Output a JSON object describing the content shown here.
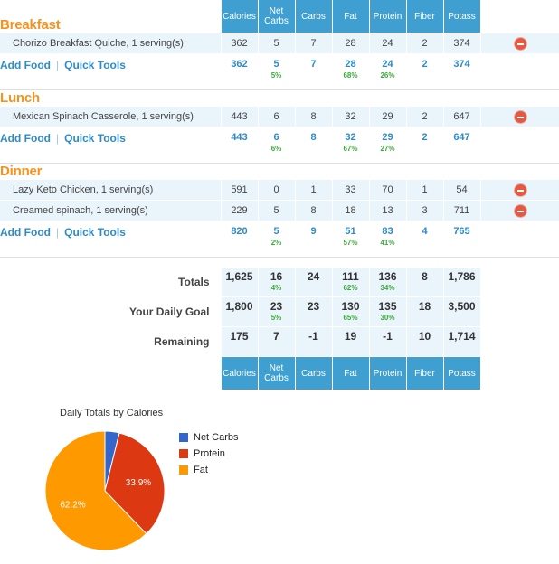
{
  "columns": [
    "Calories",
    "Net Carbs",
    "Carbs",
    "Fat",
    "Protein",
    "Fiber",
    "Potass"
  ],
  "colors": {
    "header_blue": "#3E9FD0",
    "meal_heading_orange": "#F6921E",
    "link_blue": "#2E8BC7",
    "row_bg": "#EAF4FB",
    "percent_green": "#3DA73D",
    "positive_green": "#3DA73D",
    "negative_red": "#E02020",
    "remove_red": "#E8573F"
  },
  "actions": {
    "add_food": "Add Food",
    "separator": "|",
    "quick_tools": "Quick Tools"
  },
  "meals": [
    {
      "name": "Breakfast",
      "foods": [
        {
          "name": "Chorizo Breakfast Quiche, 1 serving(s)",
          "values": [
            "362",
            "5",
            "7",
            "28",
            "24",
            "2",
            "374"
          ]
        }
      ],
      "subtotal": {
        "values": [
          "362",
          "5",
          "7",
          "28",
          "24",
          "2",
          "374"
        ],
        "percents": [
          "",
          "5%",
          "",
          "68%",
          "26%",
          "",
          ""
        ]
      }
    },
    {
      "name": "Lunch",
      "foods": [
        {
          "name": "Mexican Spinach Casserole, 1 serving(s)",
          "values": [
            "443",
            "6",
            "8",
            "32",
            "29",
            "2",
            "647"
          ]
        }
      ],
      "subtotal": {
        "values": [
          "443",
          "6",
          "8",
          "32",
          "29",
          "2",
          "647"
        ],
        "percents": [
          "",
          "6%",
          "",
          "67%",
          "27%",
          "",
          ""
        ]
      }
    },
    {
      "name": "Dinner",
      "foods": [
        {
          "name": "Lazy Keto Chicken, 1 serving(s)",
          "values": [
            "591",
            "0",
            "1",
            "33",
            "70",
            "1",
            "54"
          ]
        },
        {
          "name": "Creamed spinach, 1 serving(s)",
          "values": [
            "229",
            "5",
            "8",
            "18",
            "13",
            "3",
            "711"
          ]
        }
      ],
      "subtotal": {
        "values": [
          "820",
          "5",
          "9",
          "51",
          "83",
          "4",
          "765"
        ],
        "percents": [
          "",
          "2%",
          "",
          "57%",
          "41%",
          "",
          ""
        ]
      }
    }
  ],
  "totals_rows": [
    {
      "label": "Totals",
      "values": [
        "1,625",
        "16",
        "24",
        "111",
        "136",
        "8",
        "1,786"
      ],
      "percents": [
        "",
        "4%",
        "",
        "62%",
        "34%",
        "",
        ""
      ],
      "signs": [
        "",
        "",
        "",
        "",
        "",
        "",
        ""
      ]
    },
    {
      "label": "Your Daily Goal",
      "values": [
        "1,800",
        "23",
        "23",
        "130",
        "135",
        "18",
        "3,500"
      ],
      "percents": [
        "",
        "5%",
        "",
        "65%",
        "30%",
        "",
        ""
      ],
      "signs": [
        "",
        "",
        "",
        "",
        "",
        "",
        ""
      ]
    },
    {
      "label": "Remaining",
      "values": [
        "175",
        "7",
        "-1",
        "19",
        "-1",
        "10",
        "1,714"
      ],
      "percents": [
        "",
        "",
        "",
        "",
        "",
        "",
        ""
      ],
      "signs": [
        "pos",
        "pos",
        "neg",
        "pos",
        "neg",
        "pos",
        "pos"
      ]
    }
  ],
  "chart_data": {
    "type": "pie",
    "title": "Daily Totals by Calories",
    "legend_position": "right",
    "labels": [
      "Net Carbs",
      "Protein",
      "Fat"
    ],
    "values": [
      3.9,
      33.9,
      62.2
    ],
    "display_labels": [
      "",
      "33.9%",
      "62.2%"
    ],
    "colors": [
      "#3366CC",
      "#DC3912",
      "#FF9900"
    ],
    "units": "percent of calories"
  }
}
